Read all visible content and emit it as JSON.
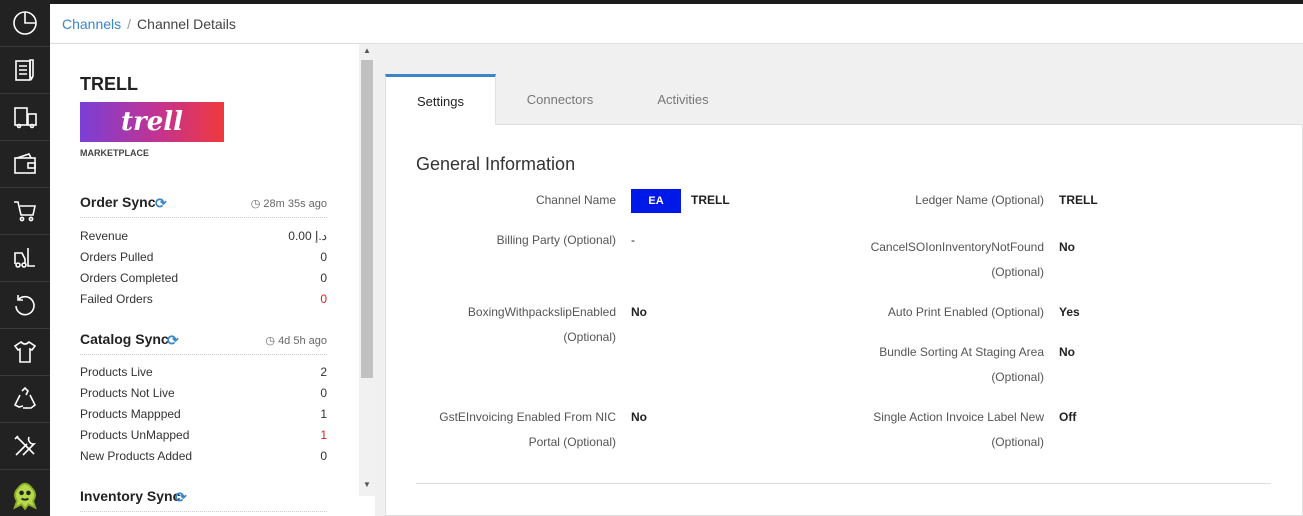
{
  "breadcrumb": {
    "parent": "Channels",
    "separator": "/",
    "current": "Channel Details"
  },
  "rail": [
    "dashboard-icon",
    "orders-icon",
    "shipping-icon",
    "wallet-icon",
    "cart-icon",
    "forklift-icon",
    "returns-icon",
    "apparel-icon",
    "recycle-icon",
    "tools-icon",
    "mascot-icon"
  ],
  "channel": {
    "name": "TRELL",
    "logo_text": "trell",
    "type": "MARKETPLACE"
  },
  "order_sync": {
    "title": "Order Sync",
    "ago": "28m 35s ago",
    "rows": [
      {
        "label": "Revenue",
        "value": "0.00 د.إ",
        "highlight": false
      },
      {
        "label": "Orders Pulled",
        "value": "0",
        "highlight": false
      },
      {
        "label": "Orders Completed",
        "value": "0",
        "highlight": false
      },
      {
        "label": "Failed Orders",
        "value": "0",
        "highlight": true
      }
    ]
  },
  "catalog_sync": {
    "title": "Catalog Sync",
    "ago": "4d 5h ago",
    "rows": [
      {
        "label": "Products Live",
        "value": "2",
        "highlight": false
      },
      {
        "label": "Products Not Live",
        "value": "0",
        "highlight": false
      },
      {
        "label": "Products Mappped",
        "value": "1",
        "highlight": false
      },
      {
        "label": "Products UnMapped",
        "value": "1",
        "highlight": true
      },
      {
        "label": "New Products Added",
        "value": "0",
        "highlight": false
      }
    ]
  },
  "inventory_sync": {
    "title": "Inventory Sync"
  },
  "tabs": [
    {
      "label": "Settings",
      "active": true
    },
    {
      "label": "Connectors",
      "active": false
    },
    {
      "label": "Activities",
      "active": false
    }
  ],
  "general": {
    "title": "General Information",
    "channel_name_label": "Channel Name",
    "channel_code": "EA",
    "channel_name": "TRELL",
    "billing_label": "Billing Party (Optional)",
    "billing_value": "-",
    "boxing_label_1": "BoxingWithpackslipEnabled",
    "boxing_label_2": "(Optional)",
    "boxing_value": "No",
    "gst_label_1": "GstEInvoicing Enabled From NIC",
    "gst_label_2": "Portal (Optional)",
    "gst_value": "No",
    "ledger_label": "Ledger Name (Optional)",
    "ledger_value": "TRELL",
    "cancel_label_1": "CancelSOIonInventoryNotFound",
    "cancel_label_2": "(Optional)",
    "cancel_value": "No",
    "autoprint_label": "Auto Print Enabled (Optional)",
    "autoprint_value": "Yes",
    "bundle_label_1": "Bundle Sorting At Staging Area",
    "bundle_label_2": "(Optional)",
    "bundle_value": "No",
    "single_label_1": "Single Action Invoice Label New",
    "single_label_2": "(Optional)",
    "single_value": "Off"
  },
  "colors": {
    "accent": "#3a86c8",
    "badge": "#0018e8",
    "alert": "#e02020",
    "rail": "#222222"
  }
}
